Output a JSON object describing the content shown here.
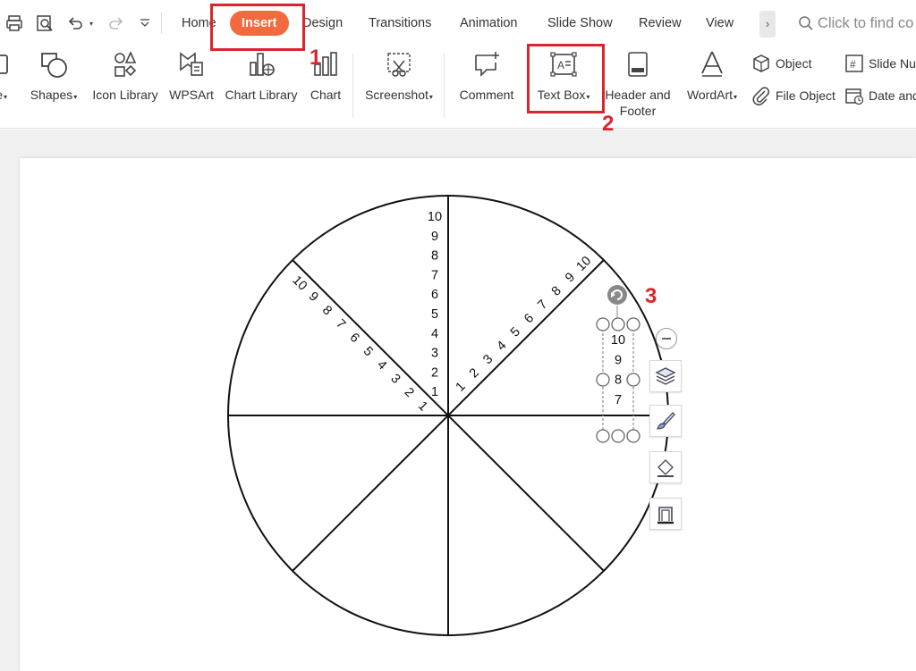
{
  "tabs": [
    {
      "id": "home",
      "label": "Home"
    },
    {
      "id": "insert",
      "label": "Insert",
      "active": true
    },
    {
      "id": "design",
      "label": "Design"
    },
    {
      "id": "transitions",
      "label": "Transitions"
    },
    {
      "id": "animation",
      "label": "Animation"
    },
    {
      "id": "slide_show",
      "label": "Slide Show"
    },
    {
      "id": "review",
      "label": "Review"
    },
    {
      "id": "view",
      "label": "View"
    }
  ],
  "more_tabs": "›",
  "search": {
    "placeholder": "Click to find co"
  },
  "ribbon": {
    "partial_label": "e",
    "shapes": "Shapes",
    "icon_library": "Icon Library",
    "wpsart": "WPSArt",
    "chart_library": "Chart Library",
    "chart": "Chart",
    "screenshot": "Screenshot",
    "comment": "Comment",
    "text_box": "Text Box",
    "header_footer_line1": "Header and",
    "header_footer_line2": "Footer",
    "wordart": "WordArt",
    "object": "Object",
    "file_object": "File Object",
    "slide_number": "Slide Nu",
    "date_time": "Date and"
  },
  "annotations": {
    "step1": "1",
    "step2": "2",
    "step3": "3"
  },
  "wheel": {
    "vertical_numbers": [
      "10",
      "9",
      "8",
      "7",
      "6",
      "5",
      "4",
      "3",
      "2",
      "1"
    ],
    "diag_left_numbers": [
      "10",
      "9",
      "8",
      "7",
      "6",
      "5",
      "4",
      "3",
      "2",
      "1"
    ],
    "diag_right_numbers": [
      "1",
      "2",
      "3",
      "4",
      "5",
      "6",
      "7",
      "8",
      "9",
      "10"
    ]
  },
  "textbox": {
    "lines": [
      "10",
      "9",
      "8",
      "7"
    ]
  },
  "colors": {
    "accent": "#f26a3d",
    "annotation": "#d9262c"
  }
}
